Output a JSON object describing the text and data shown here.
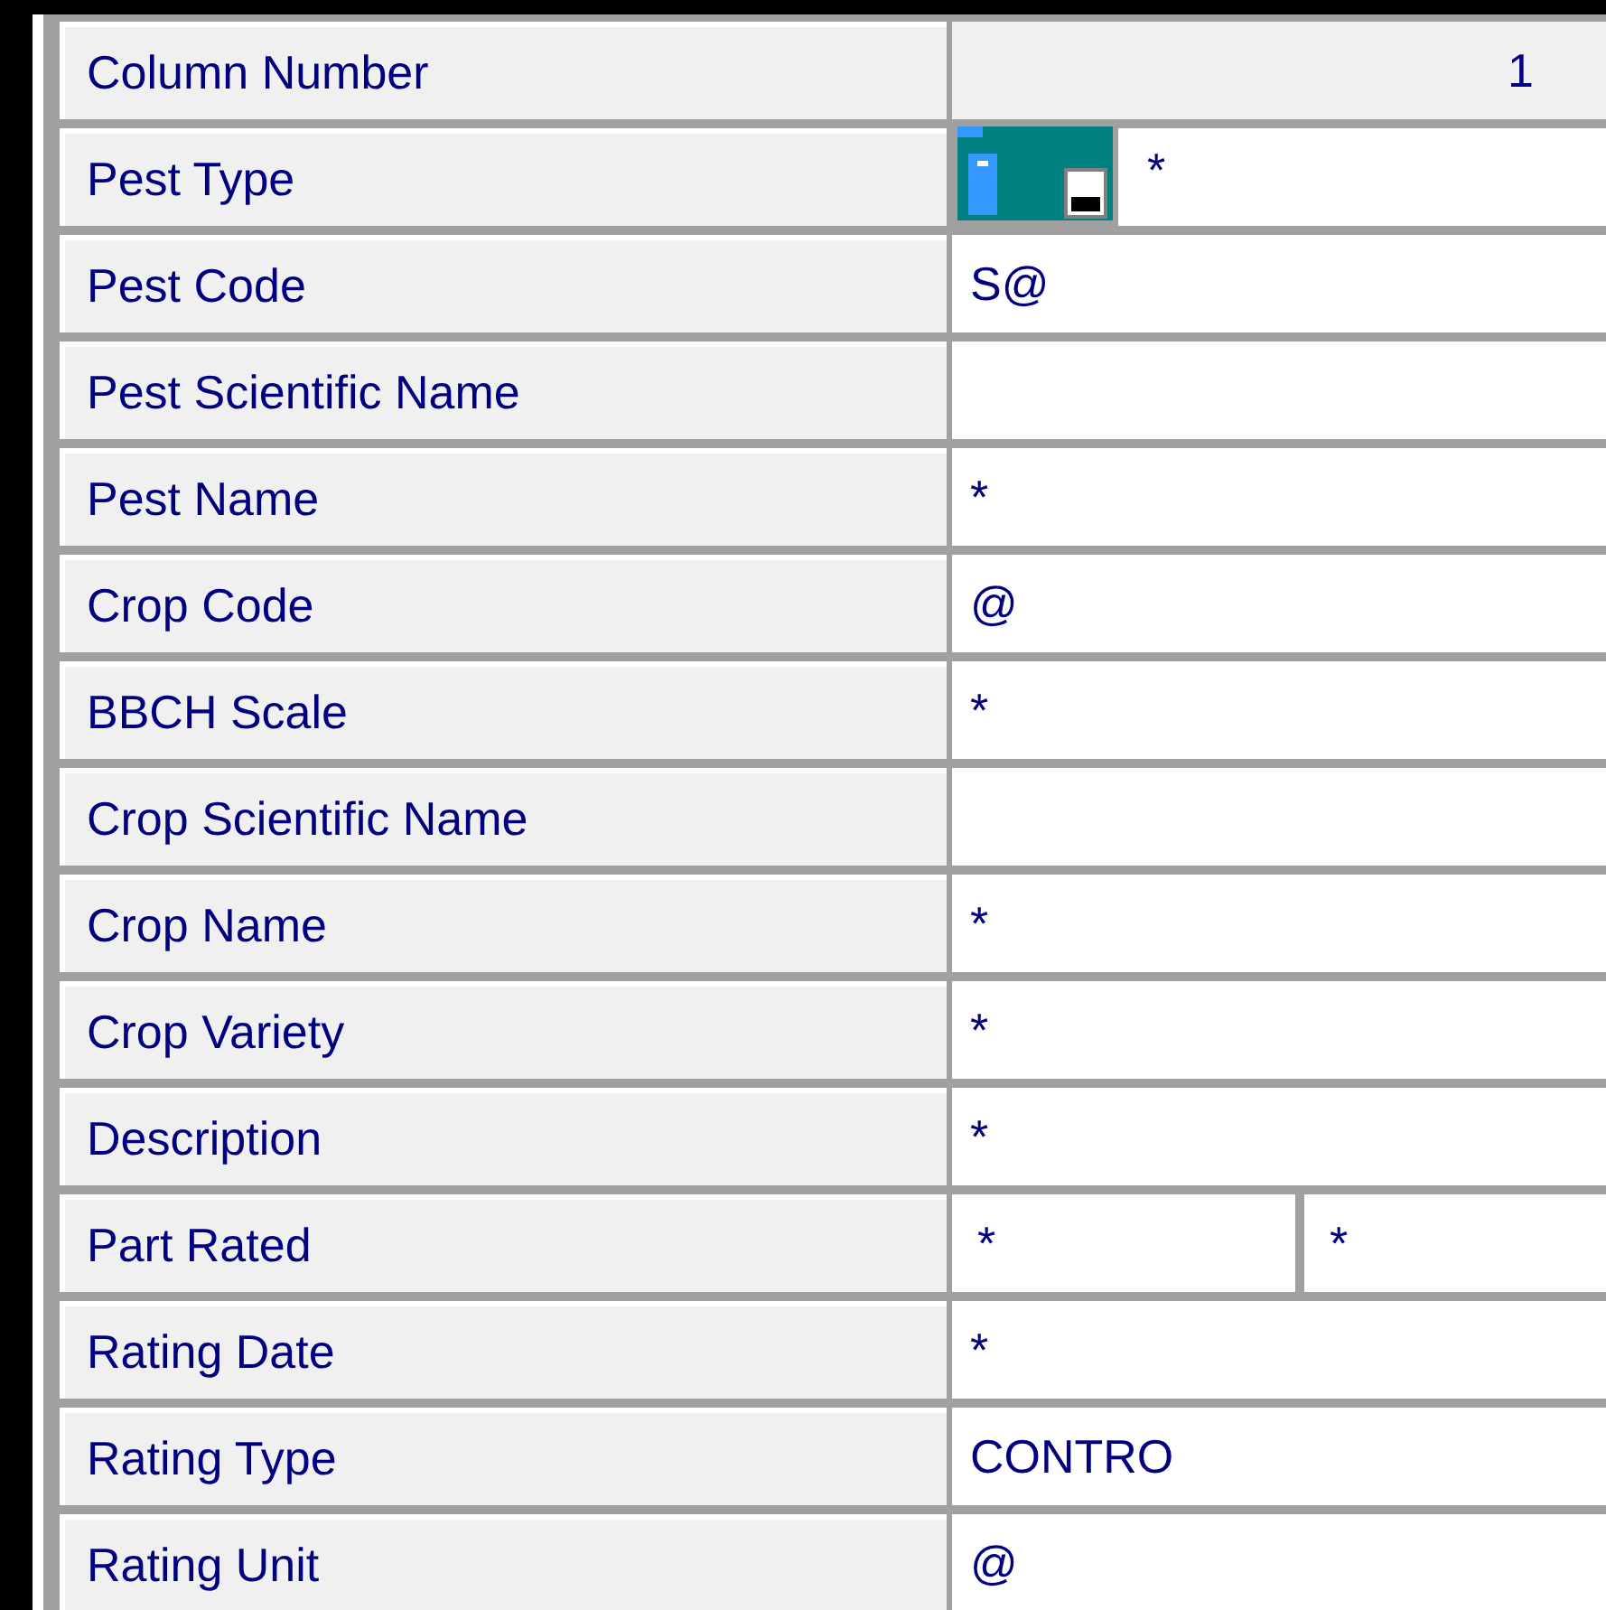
{
  "header": {
    "label": "Column Number",
    "value": "1"
  },
  "rows": [
    {
      "label": "Pest Type",
      "kind": "picker",
      "values": [
        "*"
      ]
    },
    {
      "label": "Pest Code",
      "kind": "text",
      "values": [
        "S@"
      ]
    },
    {
      "label": "Pest Scientific Name",
      "kind": "text",
      "values": []
    },
    {
      "label": "Pest Name",
      "kind": "text",
      "values": [
        "*"
      ]
    },
    {
      "label": "Crop Code",
      "kind": "text",
      "values": [
        "@"
      ]
    },
    {
      "label": "BBCH Scale",
      "kind": "text",
      "values": [
        "*"
      ]
    },
    {
      "label": "Crop Scientific Name",
      "kind": "text",
      "values": []
    },
    {
      "label": "Crop Name",
      "kind": "text",
      "values": [
        "*"
      ]
    },
    {
      "label": "Crop Variety",
      "kind": "text",
      "values": [
        "*"
      ]
    },
    {
      "label": "Description",
      "kind": "text",
      "values": [
        "*"
      ]
    },
    {
      "label": "Part Rated",
      "kind": "split",
      "values": [
        "*",
        "*"
      ]
    },
    {
      "label": "Rating Date",
      "kind": "text",
      "values": [
        "*"
      ]
    },
    {
      "label": "Rating Type",
      "kind": "text",
      "values": [
        "CONTRO"
      ]
    },
    {
      "label": "Rating Unit",
      "kind": "text",
      "values": [
        "@"
      ]
    }
  ]
}
